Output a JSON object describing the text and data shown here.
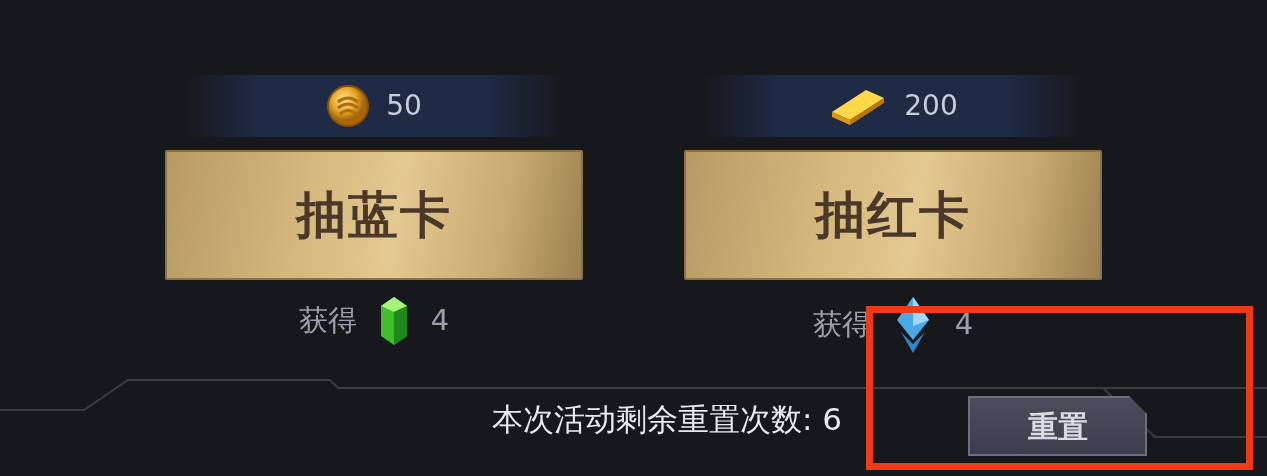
{
  "offers": [
    {
      "kind": "blue",
      "cost": "50",
      "label": "抽蓝卡",
      "reward_label": "获得",
      "reward_amount": "4"
    },
    {
      "kind": "red",
      "cost": "200",
      "label": "抽红卡",
      "reward_label": "获得",
      "reward_amount": "4"
    }
  ],
  "footer": {
    "remaining": "本次活动剩余重置次数: 6",
    "reset_button": "重置"
  }
}
